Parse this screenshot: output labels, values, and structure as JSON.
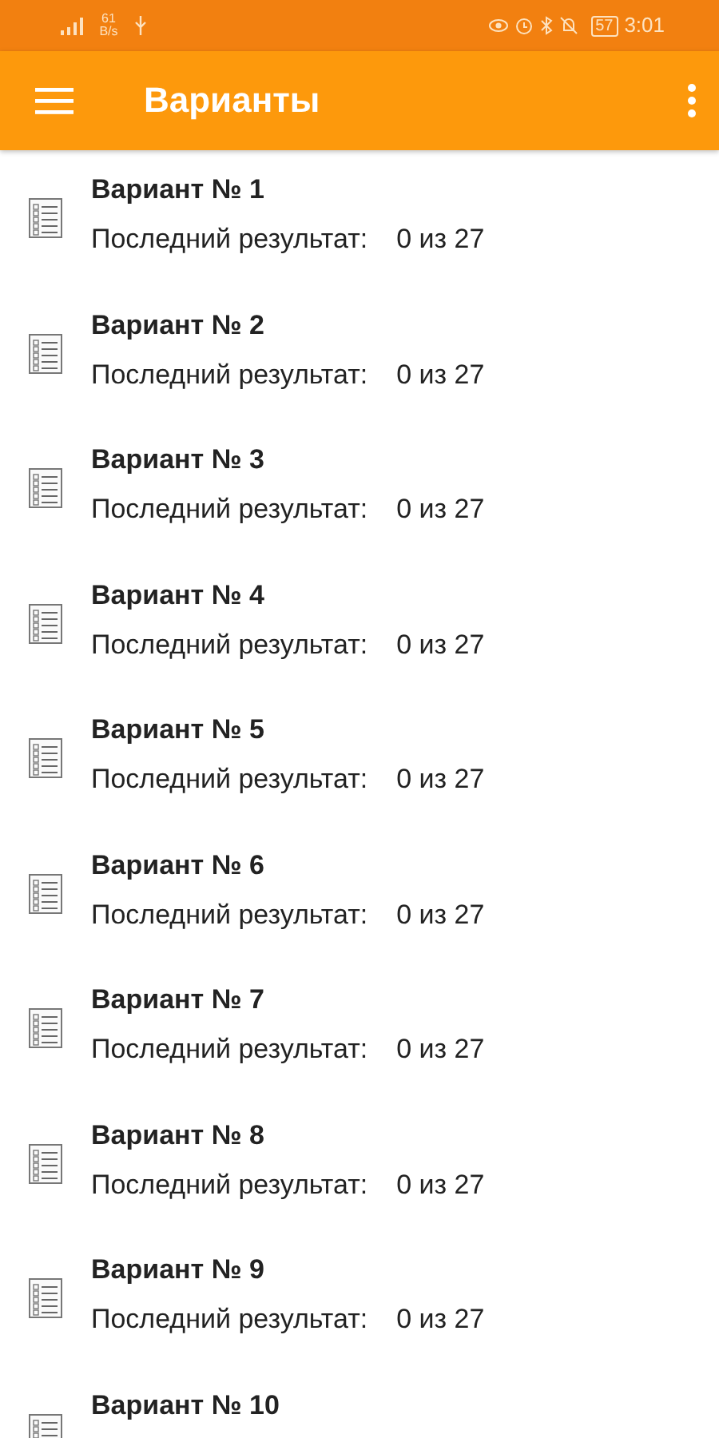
{
  "status_bar": {
    "network_speed": "61 B/s",
    "battery": "57",
    "time": "3:01"
  },
  "app_bar": {
    "title": "Варианты"
  },
  "variants": [
    {
      "title": "Вариант № 1",
      "result_label": "Последний результат:",
      "result": "0 из 27"
    },
    {
      "title": "Вариант № 2",
      "result_label": "Последний результат:",
      "result": "0 из 27"
    },
    {
      "title": "Вариант № 3",
      "result_label": "Последний результат:",
      "result": "0 из 27"
    },
    {
      "title": "Вариант № 4",
      "result_label": "Последний результат:",
      "result": "0 из 27"
    },
    {
      "title": "Вариант № 5",
      "result_label": "Последний результат:",
      "result": "0 из 27"
    },
    {
      "title": "Вариант № 6",
      "result_label": "Последний результат:",
      "result": "0 из 27"
    },
    {
      "title": "Вариант № 7",
      "result_label": "Последний результат:",
      "result": "0 из 27"
    },
    {
      "title": "Вариант № 8",
      "result_label": "Последний результат:",
      "result": "0 из 27"
    },
    {
      "title": "Вариант № 9",
      "result_label": "Последний результат:",
      "result": "0 из 27"
    },
    {
      "title": "Вариант № 10"
    }
  ]
}
